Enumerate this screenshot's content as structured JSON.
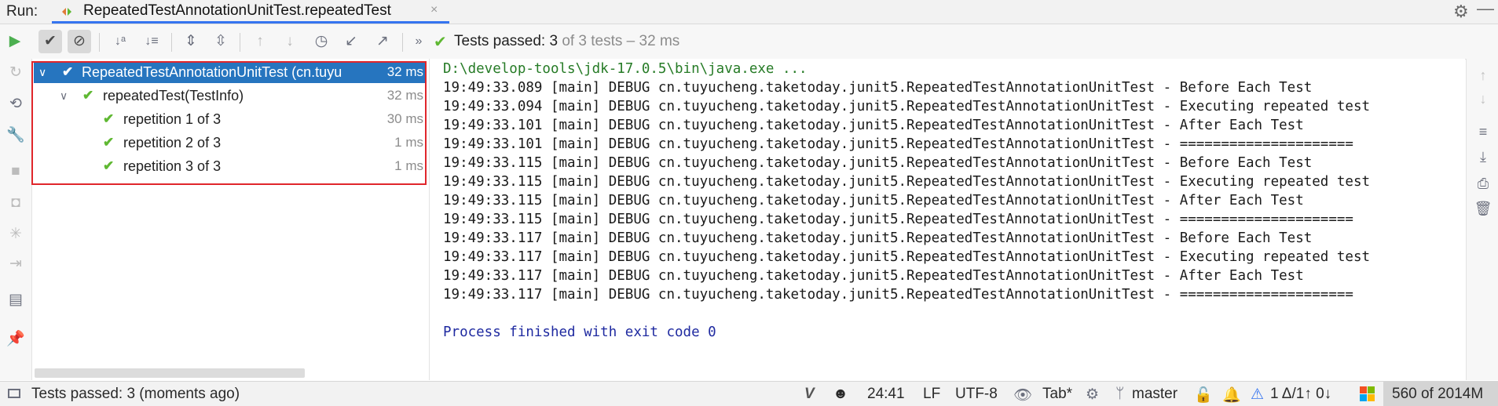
{
  "topbar": {
    "run_label": "Run:",
    "tab_title": "RepeatedTestAnnotationUnitTest.repeatedTest",
    "tab_close": "×",
    "settings_icon": "gear-icon",
    "minimize_icon": "minimize-icon"
  },
  "toolbar": {
    "buttons": [
      "rerun-icon",
      "show-passed-icon",
      "show-ignored-icon",
      "sort-alphabetically-icon",
      "sort-by-duration-icon",
      "expand-all-icon",
      "collapse-all-icon",
      "previous-failed-icon",
      "next-failed-icon",
      "test-history-icon",
      "import-tests-icon",
      "export-results-icon",
      "more-icon"
    ],
    "status_passed": "Tests passed:",
    "status_count": "3",
    "status_rest": "of 3 tests – 32 ms"
  },
  "tree": {
    "rows": [
      {
        "name": "RepeatedTestAnnotationUnitTest (cn.tuyu",
        "duration": "32 ms",
        "selected": true
      },
      {
        "name": "repeatedTest(TestInfo)",
        "duration": "32 ms"
      },
      {
        "name": "repetition 1 of 3",
        "duration": "30 ms"
      },
      {
        "name": "repetition 2 of 3",
        "duration": "1 ms"
      },
      {
        "name": "repetition 3 of 3",
        "duration": "1 ms"
      }
    ]
  },
  "console": {
    "command": "D:\\develop-tools\\jdk-17.0.5\\bin\\java.exe ...",
    "lines": [
      "19:49:33.089 [main] DEBUG cn.tuyucheng.taketoday.junit5.RepeatedTestAnnotationUnitTest - Before Each Test",
      "19:49:33.094 [main] DEBUG cn.tuyucheng.taketoday.junit5.RepeatedTestAnnotationUnitTest - Executing repeated test",
      "19:49:33.101 [main] DEBUG cn.tuyucheng.taketoday.junit5.RepeatedTestAnnotationUnitTest - After Each Test",
      "19:49:33.101 [main] DEBUG cn.tuyucheng.taketoday.junit5.RepeatedTestAnnotationUnitTest - =====================",
      "19:49:33.115 [main] DEBUG cn.tuyucheng.taketoday.junit5.RepeatedTestAnnotationUnitTest - Before Each Test",
      "19:49:33.115 [main] DEBUG cn.tuyucheng.taketoday.junit5.RepeatedTestAnnotationUnitTest - Executing repeated test",
      "19:49:33.115 [main] DEBUG cn.tuyucheng.taketoday.junit5.RepeatedTestAnnotationUnitTest - After Each Test",
      "19:49:33.115 [main] DEBUG cn.tuyucheng.taketoday.junit5.RepeatedTestAnnotationUnitTest - =====================",
      "19:49:33.117 [main] DEBUG cn.tuyucheng.taketoday.junit5.RepeatedTestAnnotationUnitTest - Before Each Test",
      "19:49:33.117 [main] DEBUG cn.tuyucheng.taketoday.junit5.RepeatedTestAnnotationUnitTest - Executing repeated test",
      "19:49:33.117 [main] DEBUG cn.tuyucheng.taketoday.junit5.RepeatedTestAnnotationUnitTest - After Each Test",
      "19:49:33.117 [main] DEBUG cn.tuyucheng.taketoday.junit5.RepeatedTestAnnotationUnitTest - ====================="
    ],
    "exit_message": "Process finished with exit code 0"
  },
  "statusbar": {
    "message": "Tests passed: 3 (moments ago)",
    "position": "24:41",
    "line_separator": "LF",
    "encoding": "UTF-8",
    "indent": "Tab*",
    "branch": "master",
    "vcs_counts": "1 Δ/1↑ 0↓",
    "memory": "560 of 2014M"
  },
  "colors": {
    "accent": "#3574f0",
    "selection": "#2675bf",
    "passed": "#5fb832",
    "highlight_box": "#e0262b",
    "command_text": "#267b26",
    "exit_text": "#1f2aa0"
  }
}
